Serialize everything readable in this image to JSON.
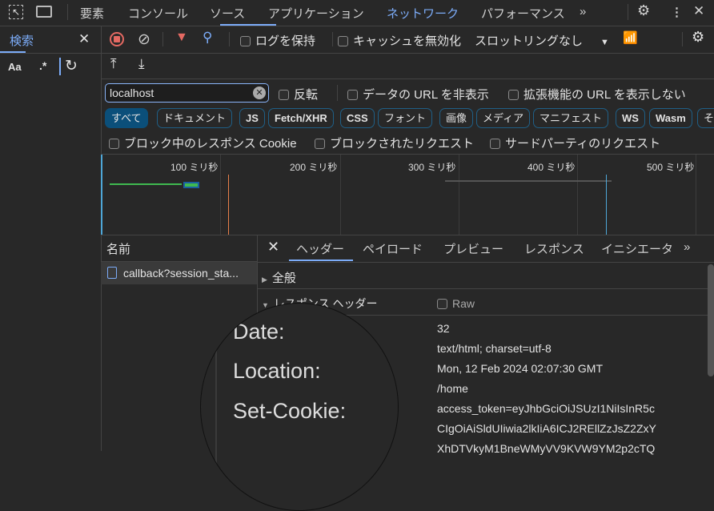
{
  "main_tabs": [
    "要素",
    "コンソール",
    "ソース",
    "アプリケーション",
    "ネットワーク",
    "パフォーマンス"
  ],
  "active_tab": "ネットワーク",
  "search_panel": {
    "title": "検索",
    "case": "Aa",
    "regex": ".*"
  },
  "toolbar": {
    "preserve_log": "ログを保持",
    "disable_cache": "キャッシュを無効化",
    "throttling": "スロットリングなし"
  },
  "filter": {
    "value": "localhost",
    "invert": "反転",
    "hide_data_urls": "データの URL を非表示",
    "hide_ext_urls": "拡張機能の URL を表示しない"
  },
  "types": [
    "すべて",
    "ドキュメント",
    "JS",
    "Fetch/XHR",
    "CSS",
    "フォント",
    "画像",
    "メディア",
    "マニフェスト",
    "WS",
    "Wasm",
    "そ"
  ],
  "checks": [
    "ブロック中のレスポンス Cookie",
    "ブロックされたリクエスト",
    "サードパーティのリクエスト"
  ],
  "timeline_ticks": [
    "100 ミリ秒",
    "200 ミリ秒",
    "300 ミリ秒",
    "400 ミリ秒",
    "500 ミリ秒"
  ],
  "name_header": "名前",
  "request": "callback?session_sta...",
  "detail_tabs": [
    "ヘッダー",
    "ペイロード",
    "プレビュー",
    "レスポンス",
    "イニシエータ"
  ],
  "sections": {
    "general": "全般",
    "response_headers": "レスポンス ヘッダー",
    "raw": "Raw"
  },
  "magnified_labels": [
    "Date:",
    "Location:",
    "Set-Cookie:"
  ],
  "values": [
    "32",
    "text/html; charset=utf-8",
    "Mon, 12 Feb 2024 02:07:30 GMT",
    "/home",
    "access_token=eyJhbGciOiJSUzI1NiIsInR5c",
    "CIgOiAiSldUIiwia2lkIiA6ICJ2REllZzJsZ2ZxY",
    "XhDTVkyM1BneWMyVV9KVW9YM2p2cTQ"
  ]
}
